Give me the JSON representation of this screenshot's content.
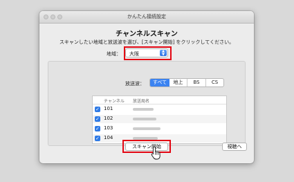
{
  "window": {
    "title": "かんたん接続設定"
  },
  "heading": "チャンネルスキャン",
  "instruction": "スキャンしたい地域と放送波を選び、[スキャン開始] をクリックしてください。",
  "region": {
    "label": "地域：",
    "value": "大阪"
  },
  "band": {
    "label": "放送波：",
    "options": [
      "すべて",
      "地上",
      "BS",
      "CS"
    ],
    "selected": "すべて"
  },
  "channel_list": {
    "columns": [
      "チャンネル",
      "放送局名"
    ],
    "rows": [
      {
        "channel": "101",
        "checked": true
      },
      {
        "channel": "102",
        "checked": true
      },
      {
        "channel": "103",
        "checked": true
      },
      {
        "channel": "104",
        "checked": true
      }
    ]
  },
  "buttons": {
    "scan_start": "スキャン開始",
    "watch": "視聴へ"
  },
  "colors": {
    "highlight": "#e30613",
    "accent": "#3b83f1"
  }
}
